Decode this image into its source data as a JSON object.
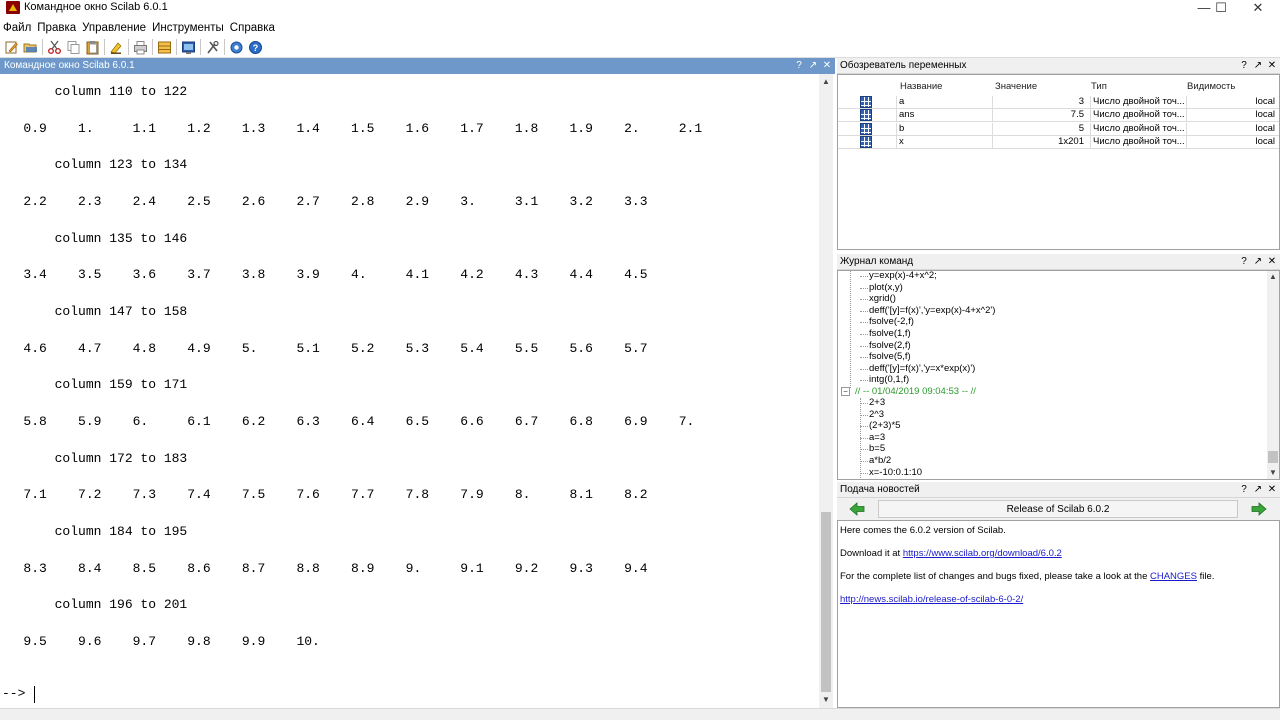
{
  "window": {
    "title": "Командное окно Scilab 6.0.1",
    "controls": {
      "minimize": "—",
      "maximize": "☐",
      "close": "✕"
    }
  },
  "menu": [
    "Файл",
    "Правка",
    "Управление",
    "Инструменты",
    "Справка"
  ],
  "toolbar": {
    "icons": [
      "new-script-icon",
      "open-folder-icon",
      "cut-icon",
      "copy-icon",
      "paste-icon",
      "clear-icon",
      "print-icon",
      "variable-browser-icon",
      "console-icon",
      "module-manager-icon",
      "demos-icon",
      "help-icon"
    ]
  },
  "console": {
    "title": "Командное окно Scilab 6.0.1",
    "header_buttons": {
      "help": "?",
      "undock": "↗",
      "close": "✕"
    },
    "lines": [
      "       column 110 to 122",
      "",
      "   0.9    1.     1.1    1.2    1.3    1.4    1.5    1.6    1.7    1.8    1.9    2.     2.1",
      "",
      "       column 123 to 134",
      "",
      "   2.2    2.3    2.4    2.5    2.6    2.7    2.8    2.9    3.     3.1    3.2    3.3",
      "",
      "       column 135 to 146",
      "",
      "   3.4    3.5    3.6    3.7    3.8    3.9    4.     4.1    4.2    4.3    4.4    4.5",
      "",
      "       column 147 to 158",
      "",
      "   4.6    4.7    4.8    4.9    5.     5.1    5.2    5.3    5.4    5.5    5.6    5.7",
      "",
      "       column 159 to 171",
      "",
      "   5.8    5.9    6.     6.1    6.2    6.3    6.4    6.5    6.6    6.7    6.8    6.9    7.",
      "",
      "       column 172 to 183",
      "",
      "   7.1    7.2    7.3    7.4    7.5    7.6    7.7    7.8    7.9    8.     8.1    8.2",
      "",
      "       column 184 to 195",
      "",
      "   8.3    8.4    8.5    8.6    8.7    8.8    8.9    9.     9.1    9.2    9.3    9.4",
      "",
      "       column 196 to 201",
      "",
      "   9.5    9.6    9.7    9.8    9.9    10."
    ],
    "prompt": "-->"
  },
  "variable_browser": {
    "title": "Обозреватель переменных",
    "columns": {
      "name": "Название",
      "value": "Значение",
      "type": "Тип",
      "visibility": "Видимость"
    },
    "rows": [
      {
        "name": "a",
        "value": "3",
        "type": "Число двойной точ...",
        "visibility": "local"
      },
      {
        "name": "ans",
        "value": "7.5",
        "type": "Число двойной точ...",
        "visibility": "local"
      },
      {
        "name": "b",
        "value": "5",
        "type": "Число двойной точ...",
        "visibility": "local"
      },
      {
        "name": "x",
        "value": "1x201",
        "type": "Число двойной точ...",
        "visibility": "local"
      }
    ]
  },
  "history": {
    "title": "Журнал команд",
    "lines_before": [
      "y=exp(x)-4+x^2;",
      "plot(x,y)",
      "xgrid()",
      "deff('[y]=f(x)','y=exp(x)-4+x^2')",
      "fsolve(-2,f)",
      "fsolve(1,f)",
      "fsolve(2,f)",
      "fsolve(5,f)",
      "deff('[y]=f(x)','y=x*exp(x)')",
      "intg(0,1,f)"
    ],
    "session_header": "// -- 01/04/2019 09:04:53 -- //",
    "lines_after": [
      "2+3",
      "2^3",
      "(2+3)*5",
      "a=3",
      "b=5",
      "a*b/2",
      "x=-10:0.1:10"
    ]
  },
  "news": {
    "title": "Подача новостей",
    "headline": "Release of Scilab 6.0.2",
    "p1": "Here comes the 6.0.2 version of Scilab.",
    "p2_prefix": "Download it at ",
    "p2_link": "https://www.scilab.org/download/6.0.2",
    "p3_prefix": "For the complete list of changes and bugs fixed, please take a look at the ",
    "p3_link": "CHANGES",
    "p3_suffix": " file.",
    "p4_link": "http://news.scilab.io/release-of-scilab-6-0-2/"
  },
  "colors": {
    "console_header": "#6d98c9",
    "history_session": "#2a9a2a",
    "link": "#1a1acc",
    "nav_arrow": "#3aa63a"
  }
}
